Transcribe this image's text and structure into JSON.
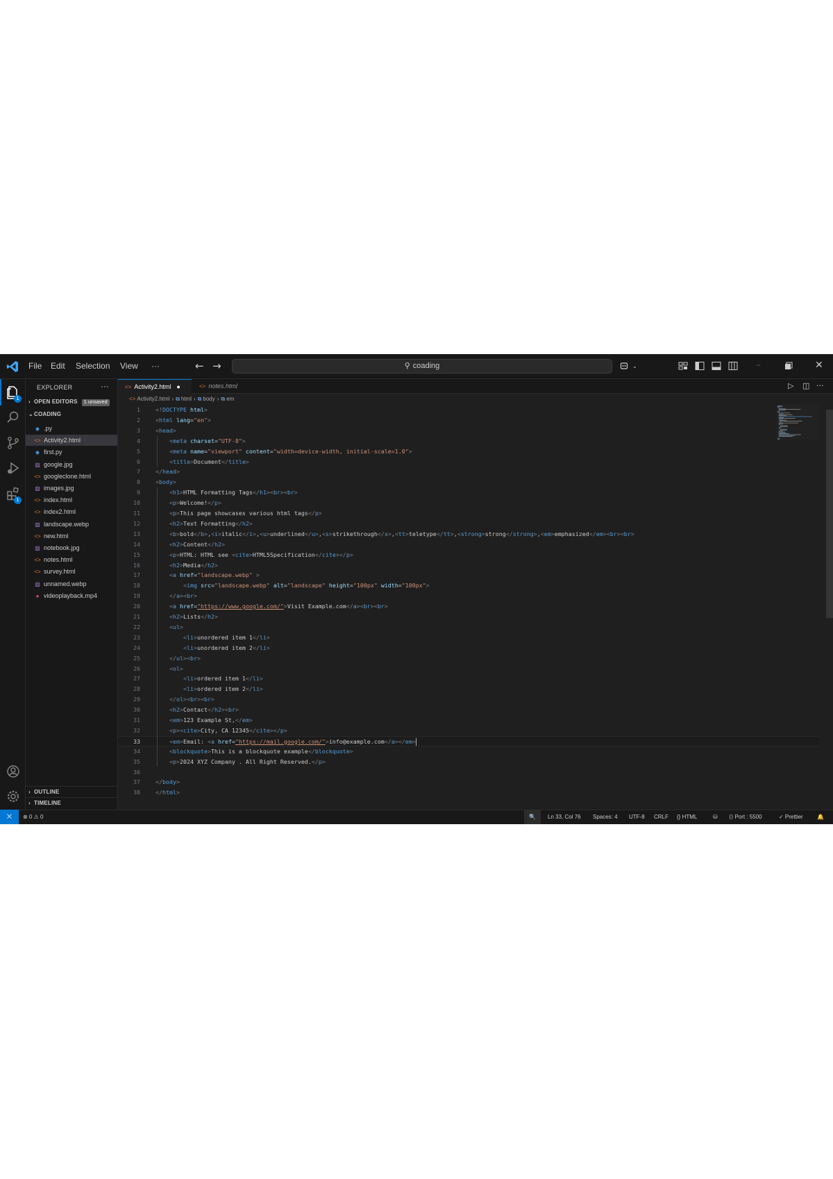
{
  "titlebar": {
    "menus": [
      "File",
      "Edit",
      "Selection",
      "View",
      "···"
    ],
    "search": "coading",
    "back": "←",
    "forward": "→"
  },
  "sidebar": {
    "title": "EXPLORER",
    "more": "···",
    "open_editors": "OPEN EDITORS",
    "unsaved": "1 unsaved",
    "folder": "COADING",
    "files": [
      {
        "name": ".py",
        "icon": "◆",
        "color": "#3d8fd6"
      },
      {
        "name": "Activity2.html",
        "icon": "<>",
        "color": "#e37933"
      },
      {
        "name": "first.py",
        "icon": "◆",
        "color": "#3d8fd6"
      },
      {
        "name": "google.jpg",
        "icon": "▨",
        "color": "#a074c4"
      },
      {
        "name": "googleclone.html",
        "icon": "<>",
        "color": "#e37933"
      },
      {
        "name": "images.jpg",
        "icon": "▨",
        "color": "#a074c4"
      },
      {
        "name": "index.html",
        "icon": "<>",
        "color": "#e37933"
      },
      {
        "name": "index2.html",
        "icon": "<>",
        "color": "#e37933"
      },
      {
        "name": "landscape.webp",
        "icon": "▨",
        "color": "#a074c4"
      },
      {
        "name": "new.html",
        "icon": "<>",
        "color": "#e37933"
      },
      {
        "name": "notebook.jpg",
        "icon": "▨",
        "color": "#a074c4"
      },
      {
        "name": "notes.html",
        "icon": "<>",
        "color": "#e37933"
      },
      {
        "name": "survey.html",
        "icon": "<>",
        "color": "#e37933"
      },
      {
        "name": "unnamed.webp",
        "icon": "▨",
        "color": "#a074c4"
      },
      {
        "name": "videoplayback.mp4",
        "icon": "●",
        "color": "#e0457b"
      }
    ],
    "outline": "OUTLINE",
    "timeline": "TIMELINE"
  },
  "tabs": [
    {
      "name": "Activity2.html",
      "active": true,
      "dirty": "●"
    },
    {
      "name": "notes.html",
      "active": false,
      "dirty": ""
    }
  ],
  "breadcrumb": [
    "Activity2.html",
    "html",
    "body",
    "em"
  ],
  "code_lines": [
    "<!DOCTYPE html>",
    "<html lang=\"en\">",
    "<head>",
    "    <meta charset=\"UTF-8\">",
    "    <meta name=\"viewport\" content=\"width=device-width, initial-scale=1.0\">",
    "    <title>Document</title>",
    "</head>",
    "<body>",
    "    <h1>HTML Formatting Tags</h1><br><br>",
    "    <p>Welcome!</p>",
    "    <p>This page showcases various html tags</p>",
    "    <h2>Text Formatting</h2>",
    "    <b>bold</b>,<i>italic</i>,<u>underlined</u>,<s>strikethrough</s>,<tt>teletype</tt>,<strong>strong</strong>,<em>emphasized</em><br><br>",
    "    <h2>Content</h2>",
    "    <p>HTML: HTML see <cite>HTML5Specification</cite></p>",
    "    <h2>Media</h2>",
    "    <a href=\"landscape.webp\" >",
    "        <img src=\"landscape.webp\" alt=\"landscape\" height=\"100px\" width=\"100px\">",
    "    </a><br>",
    "    <a href=\"https://www.google.com/\">Visit Example.com</a><br><br>",
    "    <h2>Lists</h2>",
    "    <ul>",
    "        <li>unordered item 1</li>",
    "        <li>unordered item 2</li>",
    "    </ul><br>",
    "    <ol>",
    "        <li>ordered item 1</li>",
    "        <li>ordered item 2</li>",
    "    </ol><br><br>",
    "    <h2>Contact</h2><br>",
    "    <em>123 Example St,</em>",
    "    <p><cite>City, CA 12345</cite></p>",
    "    <em>Email: <a href=\"https://mail.google.com/\">info@example.com</a></em>",
    "    <blockquote>This is a blockquote example</blockquote>",
    "    <p>2024 XYZ Company . All Right Reserved.</p>",
    "",
    "</body>",
    "</html>"
  ],
  "current_line": 33,
  "status": {
    "remote": "⨉",
    "problems": "⊗ 0  ⚠ 0",
    "search": "🔍",
    "position": "Ln 33, Col 76",
    "spaces": "Spaces: 4",
    "encoding": "UTF-8",
    "eol": "CRLF",
    "language": "{} HTML",
    "port": "⟨⟩ Port : 5500",
    "prettier": "✓ Prettier",
    "notifications": "🔔"
  },
  "colors": {
    "accent": "#0078d4",
    "background": "#1f1f1f",
    "sidebar": "#181818",
    "tag": "#569cd6",
    "attribute": "#9cdcfe",
    "string": "#ce9178"
  }
}
